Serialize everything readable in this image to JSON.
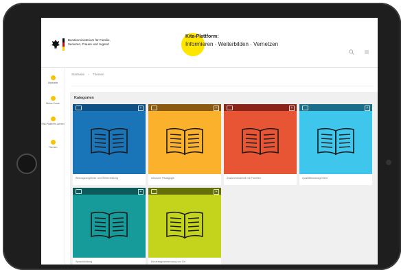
{
  "header": {
    "ministry_name": "Bundesministerium für Familie, Senioren, Frauen und Jugend",
    "platform_title": "Kita-Plattform:",
    "platform_subtitle": "Informieren · Weiterbilden · Vernetzen"
  },
  "sidebar": {
    "items": [
      {
        "label": "Startseite",
        "icon": "home-icon"
      },
      {
        "label": "Meine Kurse",
        "icon": "courses-icon"
      },
      {
        "label": "Kita-Plattform Lernen",
        "icon": "learn-icon"
      },
      {
        "label": "Themen",
        "icon": "topics-icon"
      }
    ]
  },
  "breadcrumb": [
    "Startseite",
    "›",
    "Themen"
  ],
  "section_title": "Kategorien",
  "categories": [
    {
      "label": "Bildungsangebote und Weiterbildung",
      "color": "#1a74b8",
      "top": "#0e4f84"
    },
    {
      "label": "Inklusive Pädagogik",
      "color": "#fbb12b",
      "top": "#8a5a10"
    },
    {
      "label": "Zusammenarbeit mit Familien",
      "color": "#e85534",
      "top": "#8a2418"
    },
    {
      "label": "Qualitätsmanagement",
      "color": "#3fc6ec",
      "top": "#1a6e8a"
    },
    {
      "label": "Sprachbildung",
      "color": "#179a9a",
      "top": "#0c5a5a"
    },
    {
      "label": "Kindertagesbetreuung vor Ort",
      "color": "#c4d41c",
      "top": "#66700a"
    }
  ],
  "colors": {
    "accent": "#ffe600",
    "sidebar_icon": "#f5c400"
  }
}
